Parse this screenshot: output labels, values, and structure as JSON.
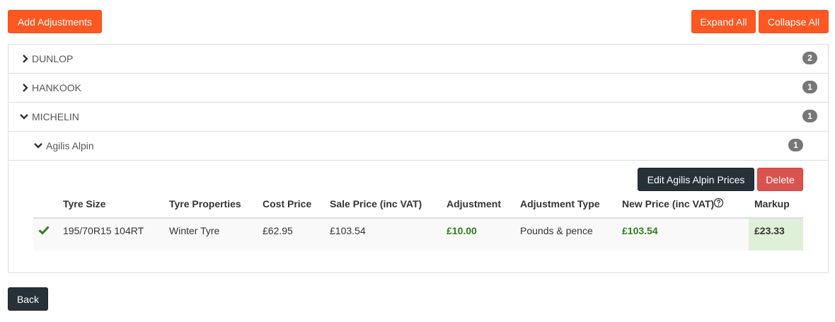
{
  "toolbar": {
    "add_adjustments": "Add Adjustments",
    "expand_all": "Expand All",
    "collapse_all": "Collapse All"
  },
  "brands": [
    {
      "name": "DUNLOP",
      "count": "2",
      "expanded": false
    },
    {
      "name": "HANKOOK",
      "count": "1",
      "expanded": false
    },
    {
      "name": "MICHELIN",
      "count": "1",
      "expanded": true
    }
  ],
  "model": {
    "name": "Agilis Alpin",
    "count": "1",
    "expanded": true,
    "edit_button": "Edit Agilis Alpin Prices",
    "delete_button": "Delete"
  },
  "table": {
    "headers": [
      "Tyre Size",
      "Tyre Properties",
      "Cost Price",
      "Sale Price (inc VAT)",
      "Adjustment",
      "Adjustment Type",
      "New Price (inc VAT)",
      "Markup"
    ],
    "rows": [
      {
        "status_icon": "check-icon",
        "tyre_size": "195/70R15 104RT",
        "tyre_properties": "Winter Tyre",
        "cost_price": "£62.95",
        "sale_price": "£103.54",
        "adjustment": "£10.00",
        "adjustment_type": "Pounds & pence",
        "new_price": "£103.54",
        "markup": "£23.33"
      }
    ]
  },
  "footer": {
    "back": "Back"
  },
  "colors": {
    "accent": "#ff5722",
    "dark": "#263238",
    "danger": "#d9534f",
    "success_text": "#2e7d1a",
    "markup_bg": "#dff0d8",
    "badge": "#777777"
  },
  "icons": {
    "collapsed": "chevron-right-icon",
    "expanded": "chevron-down-icon",
    "help": "question-circle-icon"
  }
}
